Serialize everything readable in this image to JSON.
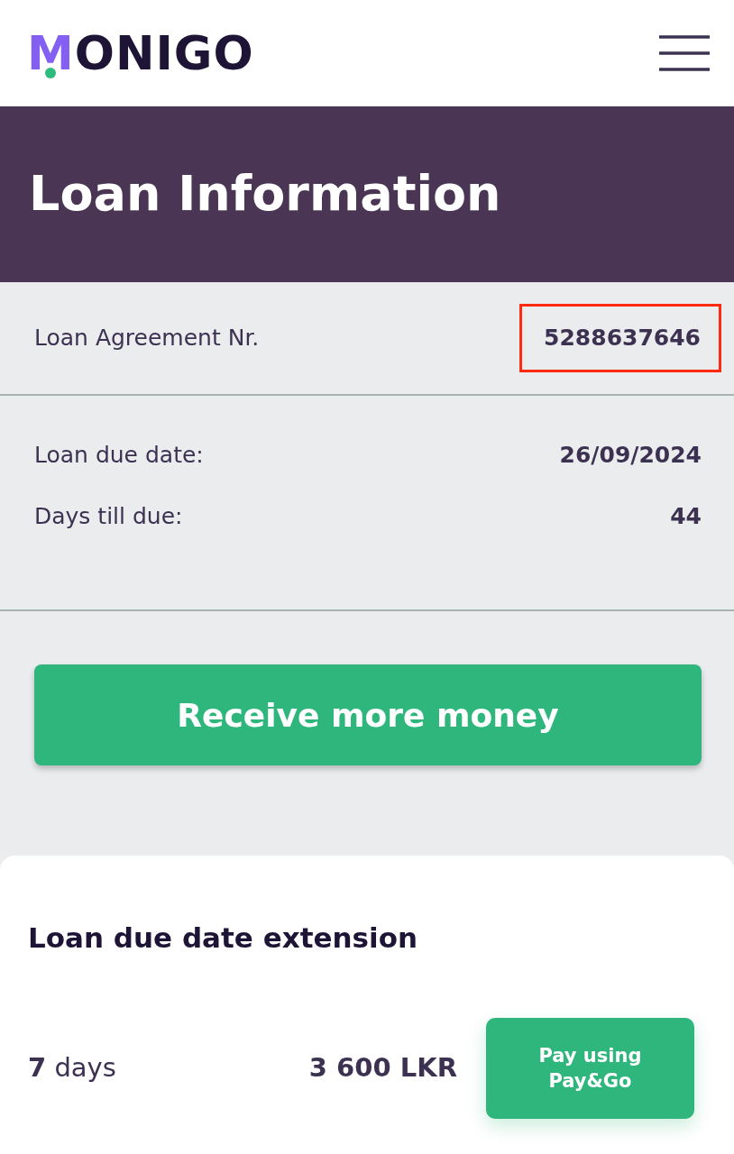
{
  "header": {
    "logo": "MONIGO"
  },
  "banner": {
    "title": "Loan Information"
  },
  "agreement": {
    "label": "Loan Agreement Nr.",
    "value": "5288637646",
    "highlighted": true
  },
  "details": [
    {
      "label": "Loan due date:",
      "value": "26/09/2024"
    },
    {
      "label": "Days till due:",
      "value": "44"
    }
  ],
  "primary_button": {
    "label": "Receive more money"
  },
  "extension": {
    "title": "Loan due date extension",
    "options": [
      {
        "duration": "**7** days",
        "price": "3 600 LKR",
        "button": "Pay using Pay&Go"
      }
    ]
  }
}
